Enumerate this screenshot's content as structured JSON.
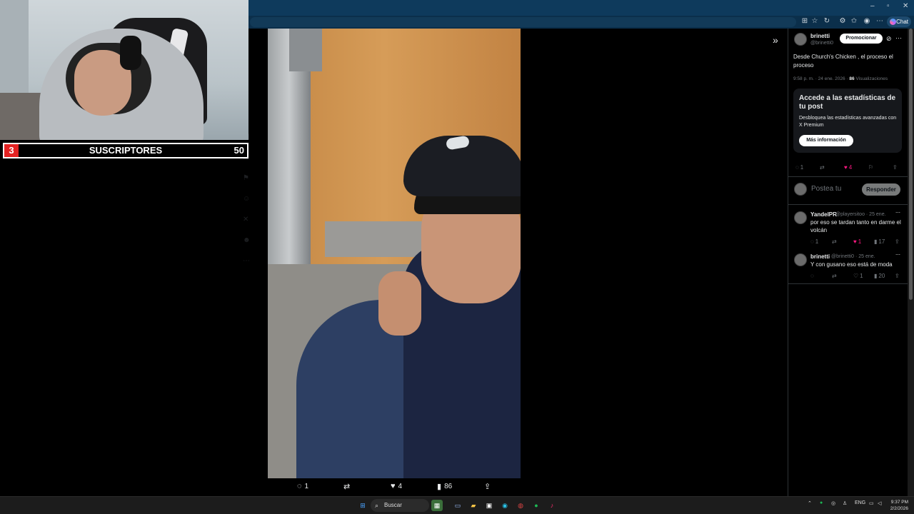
{
  "browser": {
    "window_controls": [
      "–",
      "▫",
      "✕"
    ],
    "chat_label": "Chat"
  },
  "overlay": {
    "sub_current": "3",
    "sub_label": "SUSCRIPTORES",
    "sub_goal": "50"
  },
  "photo_actions": {
    "replies": "1",
    "reposts": "",
    "likes": "4",
    "views": "86"
  },
  "post": {
    "author_name": "brinetti",
    "author_handle": "@brinetti0",
    "promote_label": "Promocionar",
    "text": "Desde Church's Chicken , el proceso el proceso",
    "time": "9:58 p. m. · 24 ene. 2026 ·",
    "views_count": "86",
    "views_label": "Visualizaciones",
    "stats_title": "Accede a las estadísticas de tu post",
    "stats_desc": "Desbloquea las estadísticas avanzadas con X Premium",
    "stats_button": "Más información",
    "replies": "1",
    "likes": "4",
    "reply_placeholder": "Postea tu",
    "reply_button": "Responder"
  },
  "replies": [
    {
      "name": "YandelPR",
      "handle": "@playersitoo · 25 ene.",
      "text": "por eso se tardan tanto en darme el volcán",
      "replies": "1",
      "likes": "1",
      "views": "17"
    },
    {
      "name": "brinetti",
      "handle": "@brinetti0 · 25 ene.",
      "text": "Y con gusano eso está de moda",
      "replies": "",
      "likes": "1",
      "views": "20"
    }
  ],
  "taskbar": {
    "search_label": "Buscar",
    "lang": "ENG",
    "time": "9:37 PM",
    "date": "2/2/2026"
  },
  "colors": {
    "like_pink": "#f91880",
    "sub_red": "#e32222",
    "panel_card": "#16181c"
  }
}
